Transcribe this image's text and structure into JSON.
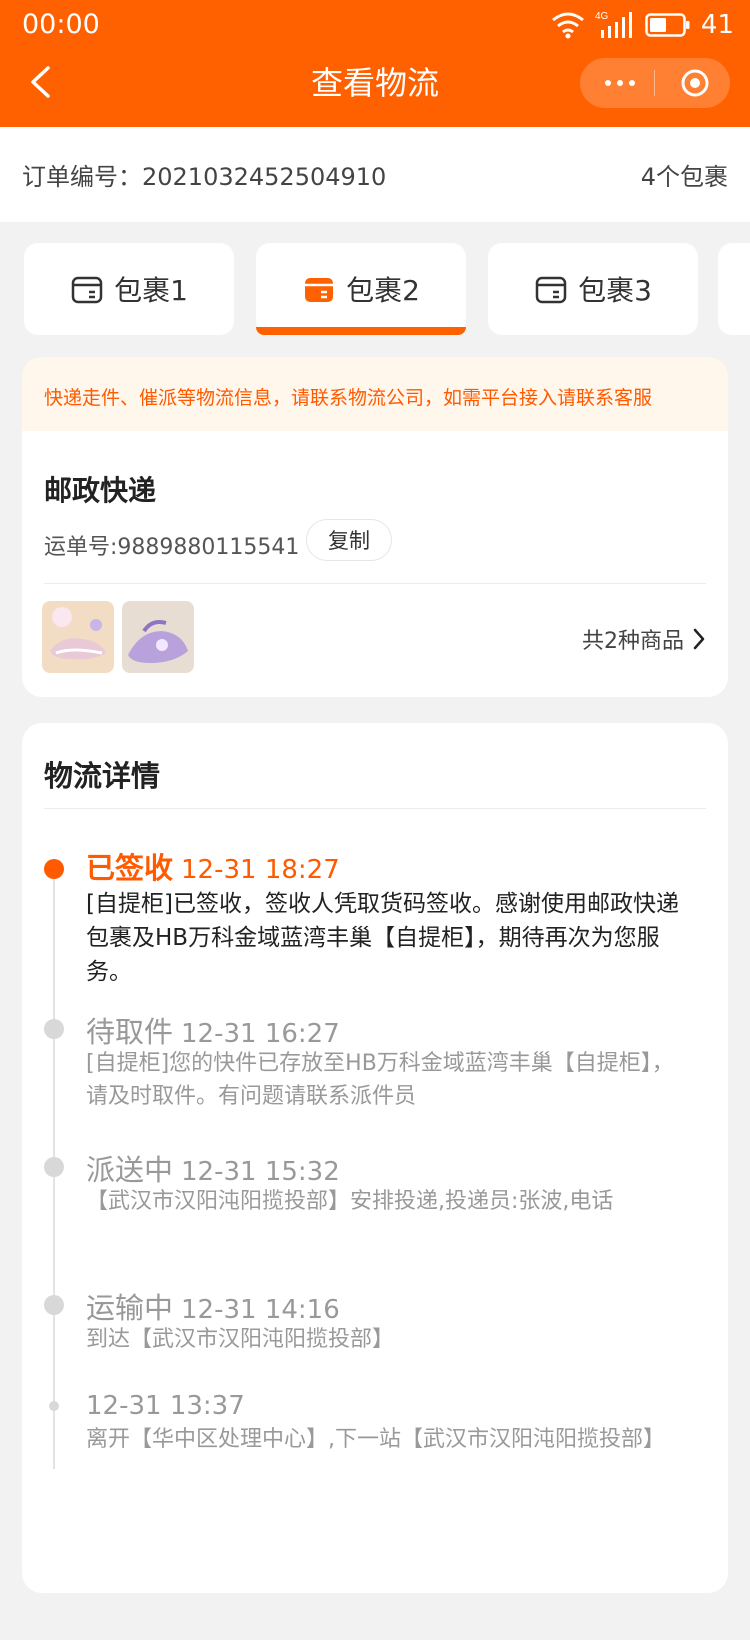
{
  "status_bar": {
    "time": "00:00",
    "network": "4G",
    "battery": "41"
  },
  "nav": {
    "title": "查看物流",
    "back_icon": "chevron-left-icon",
    "more_icon": "more-dots-icon",
    "close_icon": "target-circle-icon"
  },
  "colors": {
    "brand": "#ff6000",
    "accent_text": "#ff5a00",
    "notice_bg": "#fff6ec"
  },
  "order": {
    "label": "订单编号：2021032452504910",
    "package_count": "4个包裹"
  },
  "tabs": [
    {
      "label": "包裹1",
      "active": false
    },
    {
      "label": "包裹2",
      "active": true
    },
    {
      "label": "包裹3",
      "active": false
    }
  ],
  "express": {
    "notice": "快递走件、催派等物流信息，请联系物流公司，如需平台接入请联系客服",
    "carrier": "邮政快递",
    "waybill": "运单号:9889880115541",
    "copy_label": "复制",
    "goods_count": "共2种商品"
  },
  "detail": {
    "title": "物流详情",
    "events": [
      {
        "status": "已签收",
        "time": "12-31 18:27",
        "desc": "[自提柜]已签收，签收人凭取货码签收。感谢使用邮政快递包裹及HB万科金域蓝湾丰巢【自提柜】，期待再次为您服务。"
      },
      {
        "status": "待取件",
        "time": "12-31 16:27",
        "desc": "[自提柜]您的快件已存放至HB万科金域蓝湾丰巢【自提柜】，请及时取件。有问题请联系派件员"
      },
      {
        "status": "派送中",
        "time": "12-31 15:32",
        "desc": "【武汉市汉阳沌阳揽投部】安排投递,投递员:张波,电话"
      },
      {
        "status": "运输中",
        "time": "12-31 14:16",
        "desc": "到达【武汉市汉阳沌阳揽投部】"
      },
      {
        "status": "",
        "time": "12-31 13:37",
        "desc": "离开【华中区处理中心】,下一站【武汉市汉阳沌阳揽投部】"
      }
    ]
  }
}
